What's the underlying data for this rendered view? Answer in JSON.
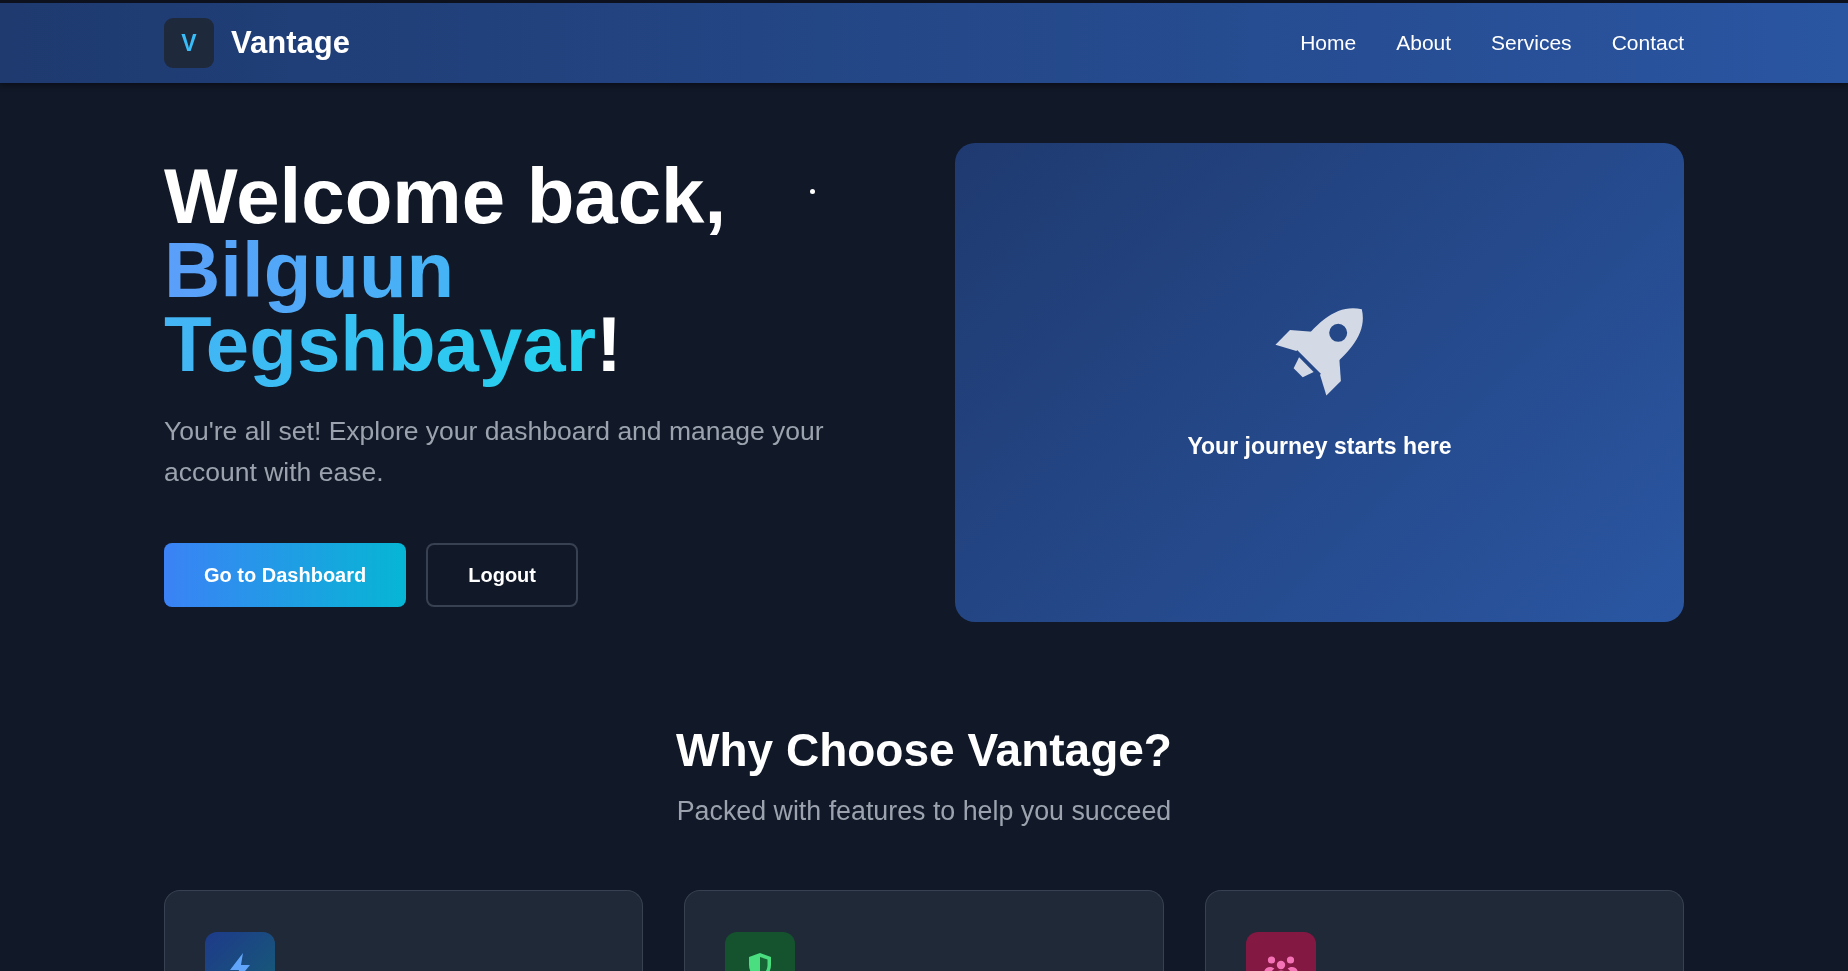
{
  "header": {
    "logo": {
      "mark": "V",
      "name": "Vantage"
    },
    "nav": [
      "Home",
      "About",
      "Services",
      "Contact"
    ]
  },
  "hero": {
    "heading": {
      "greeting": "Welcome back,",
      "name": "Bilguun Tegshbayar",
      "ending": "!"
    },
    "text": "You're all set! Explore your dashboard and manage your account with ease.",
    "buttons": [
      {
        "label": "Go to Dashboard",
        "kind": "primary"
      },
      {
        "label": "Logout",
        "kind": "outline"
      }
    ],
    "card": {
      "caption": "Your journey starts here"
    }
  },
  "features": {
    "title": "Why Choose Vantage?",
    "subtitle": "Packed with features to help you succeed",
    "cards": [
      {
        "kind": "bolt"
      },
      {
        "kind": "shield"
      },
      {
        "kind": "people"
      }
    ]
  }
}
